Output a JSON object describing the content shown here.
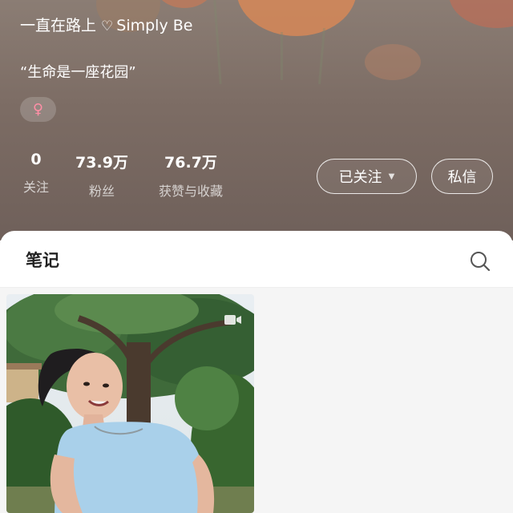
{
  "profile": {
    "name": "一直在路上",
    "heart_glyph": "♡",
    "name_suffix": "Simply Be",
    "bio": "“生命是一座花园”",
    "gender_symbol": "♀"
  },
  "stats": [
    {
      "value": "0",
      "label": "关注"
    },
    {
      "value": "73.9万",
      "label": "粉丝"
    },
    {
      "value": "76.7万",
      "label": "获赞与收藏"
    }
  ],
  "actions": {
    "followed_label": "已关注",
    "message_label": "私信"
  },
  "tabs": {
    "notes_label": "笔记"
  },
  "icons": {
    "search": "search-icon",
    "video": "video-icon",
    "dropdown": "caret-down-icon",
    "gender": "female-icon"
  },
  "colors": {
    "header_bg": "#7c6c64",
    "gender_accent": "#ff8fa6",
    "sheet_bg": "#ffffff",
    "grid_bg": "#f5f5f5"
  }
}
